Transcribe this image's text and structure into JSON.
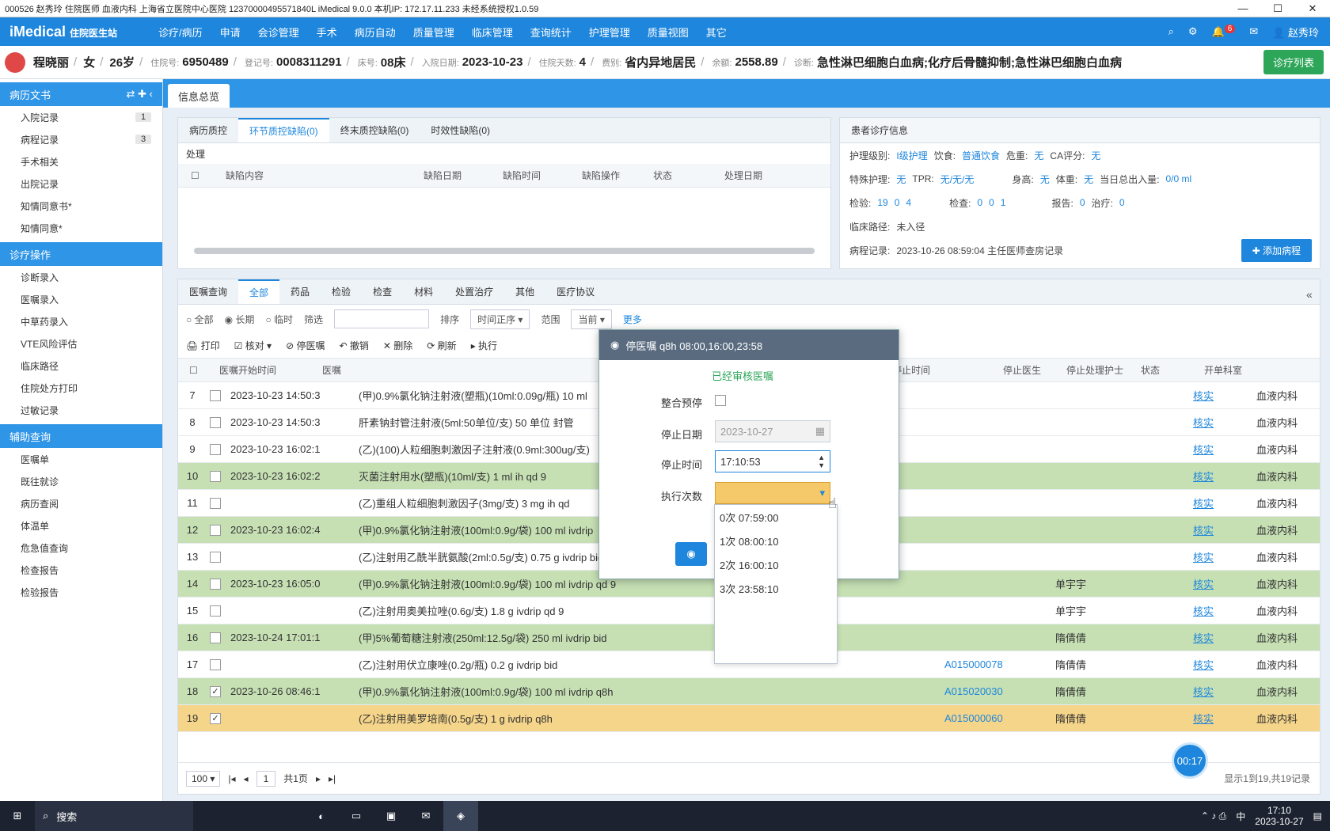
{
  "window": {
    "title": "000526 赵秀玲 住院医师 血液内科 上海省立医院中心医院 12370000495571840L iMedical 9.0.0 本机IP: 172.17.11.233 未经系统授权1.0.59"
  },
  "nav": {
    "logo": "iMedical",
    "sub": "住院医生站",
    "menu": [
      "诊疗/病历",
      "申请",
      "会诊管理",
      "手术",
      "病历自动",
      "质量管理",
      "临床管理",
      "查询统计",
      "护理管理",
      "质量视图",
      "其它"
    ],
    "user": "赵秀玲",
    "badge": "6"
  },
  "patient": {
    "name": "程晓丽",
    "sex": "女",
    "age": "26岁",
    "reg_label": "住院号:",
    "reg_no": "6950489",
    "card_label": "登记号:",
    "card_no": "0008311291",
    "bed_label": "床号:",
    "bed": "08床",
    "admit_label": "入院日期:",
    "admit_date": "2023-10-23",
    "days_label": "住院天数:",
    "days": "4",
    "type_label": "费别:",
    "type": "省内异地居民",
    "fee_label": "余额:",
    "fee": "2558.89",
    "diag_label": "诊断:",
    "diagnosis": "急性淋巴细胞白血病;化疗后骨髓抑制;急性淋巴细胞白血病",
    "btn": "诊疗列表"
  },
  "sidebar": {
    "sec1": "病历文书",
    "items1": [
      {
        "label": "入院记录",
        "count": "1"
      },
      {
        "label": "病程记录",
        "count": "3"
      },
      {
        "label": "手术相关",
        "count": ""
      },
      {
        "label": "出院记录",
        "count": ""
      },
      {
        "label": "知情同意书*",
        "count": ""
      },
      {
        "label": "知情同意*",
        "count": ""
      }
    ],
    "sec2": "诊疗操作",
    "items2": [
      "诊断录入",
      "医嘱录入",
      "中草药录入",
      "VTE风险评估",
      "临床路径",
      "住院处方打印",
      "过敏记录"
    ],
    "sec3": "辅助查询",
    "items3": [
      "医嘱单",
      "既往就诊",
      "病历查阅",
      "体温单",
      "危急值查询",
      "检查报告",
      "检验报告"
    ]
  },
  "tab": {
    "label": "信息总览"
  },
  "top_panel": {
    "tabs": [
      "病历质控",
      "环节质控缺陷(0)",
      "终末质控缺陷(0)",
      "时效性缺陷(0)"
    ],
    "section": "处理",
    "cols": [
      "缺陷内容",
      "缺陷日期",
      "缺陷时间",
      "缺陷操作",
      "状态",
      "处理日期"
    ]
  },
  "info_panel": {
    "title": "患者诊疗信息",
    "r1": [
      "护理级别:",
      "I级护理",
      "饮食:",
      "普通饮食",
      "危重:",
      "无",
      "CA评分:",
      "无"
    ],
    "r2": [
      "特殊护理:",
      "无",
      "TPR:",
      "无/无/无",
      "身高:",
      "无",
      "体重:",
      "无",
      "当日总出入量:",
      "0/0 ml"
    ],
    "r3": [
      "检验:",
      "19",
      "0",
      "4",
      "检查:",
      "0",
      "0",
      "1",
      "报告:",
      "0",
      "治疗:",
      "0"
    ],
    "r4": [
      "临床路径:",
      "未入径"
    ],
    "r5": [
      "病程记录:",
      "2023-10-26 08:59:04 主任医师查房记录"
    ],
    "btn": "添加病程"
  },
  "orders": {
    "tabs": [
      "医嘱查询",
      "全部",
      "药品",
      "检验",
      "检查",
      "材料",
      "处置治疗",
      "其他",
      "医疗协议"
    ],
    "filters": [
      "全部",
      "长期",
      "临时",
      "筛选",
      "排序",
      "时间正序",
      "范围",
      "当前",
      "更多"
    ],
    "toolbar": [
      "打印",
      "核对",
      "停医嘱",
      "撤销",
      "删除",
      "刷新",
      "执行"
    ],
    "cols": [
      "医嘱开始时间",
      "医嘱",
      "停止时间",
      "停止医生",
      "停止处理护士",
      "状态",
      "开单科室"
    ],
    "rows": [
      {
        "n": "7",
        "chk": "",
        "t": "2023-10-23 14:50:3",
        "o": "(甲)0.9%氯化钠注射液(塑瓶)(10ml:0.09g/瓶) 10 ml",
        "c": "",
        "d": "",
        "s": "核实",
        "dept": "血液内科",
        "cls": "white"
      },
      {
        "n": "8",
        "chk": "",
        "t": "2023-10-23 14:50:3",
        "o": "肝素钠封管注射液(5ml:50单位/支) 50 单位 封管",
        "c": "",
        "d": "",
        "s": "核实",
        "dept": "血液内科",
        "cls": "white"
      },
      {
        "n": "9",
        "chk": "",
        "t": "2023-10-23 16:02:1",
        "o": "(乙)(100)人粒细胞刺激因子注射液(0.9ml:300ug/支)",
        "c": "",
        "d": "",
        "s": "核实",
        "dept": "血液内科",
        "cls": "white"
      },
      {
        "n": "10",
        "chk": "",
        "t": "2023-10-23 16:02:2",
        "o": "灭菌注射用水(塑瓶)(10ml/支) 1 ml ih qd 9",
        "c": "",
        "d": "",
        "s": "核实",
        "dept": "血液内科",
        "cls": "green"
      },
      {
        "n": "11",
        "chk": "",
        "t": "",
        "o": "(乙)重组人粒细胞刺激因子(3mg/支) 3 mg ih qd",
        "c": "",
        "d": "",
        "s": "核实",
        "dept": "血液内科",
        "cls": "white"
      },
      {
        "n": "12",
        "chk": "",
        "t": "2023-10-23 16:02:4",
        "o": "(甲)0.9%氯化钠注射液(100ml:0.9g/袋) 100 ml ivdrip",
        "c": "",
        "d": "",
        "s": "核实",
        "dept": "血液内科",
        "cls": "green"
      },
      {
        "n": "13",
        "chk": "",
        "t": "",
        "o": "(乙)注射用乙酰半胱氨酸(2ml:0.5g/支) 0.75 g ivdrip bid",
        "c": "",
        "d": "",
        "s": "核实",
        "dept": "血液内科",
        "cls": "white"
      },
      {
        "n": "14",
        "chk": "",
        "t": "2023-10-23 16:05:0",
        "o": "(甲)0.9%氯化钠注射液(100ml:0.9g/袋) 100 ml ivdrip qd 9",
        "c": "",
        "d": "单宇宇",
        "s": "核实",
        "dept": "血液内科",
        "cls": "green"
      },
      {
        "n": "15",
        "chk": "",
        "t": "",
        "o": "(乙)注射用奥美拉唑(0.6g/支) 1.8 g ivdrip qd 9",
        "c": "",
        "d": "单宇宇",
        "s": "核实",
        "dept": "血液内科",
        "cls": "white"
      },
      {
        "n": "16",
        "chk": "",
        "t": "2023-10-24 17:01:1",
        "o": "(甲)5%葡萄糖注射液(250ml:12.5g/袋) 250 ml ivdrip bid",
        "c": "",
        "d": "隋倩倩",
        "s": "核实",
        "dept": "血液内科",
        "cls": "green"
      },
      {
        "n": "17",
        "chk": "",
        "t": "",
        "o": "(乙)注射用伏立康唑(0.2g/瓶) 0.2 g ivdrip bid",
        "c": "A015000078",
        "d": "隋倩倩",
        "s": "核实",
        "dept": "血液内科",
        "cls": "white"
      },
      {
        "n": "18",
        "chk": "✓",
        "t": "2023-10-26 08:46:1",
        "o": "(甲)0.9%氯化钠注射液(100ml:0.9g/袋) 100 ml ivdrip q8h",
        "c": "A015020030",
        "d": "隋倩倩",
        "s": "核实",
        "dept": "血液内科",
        "cls": "green"
      },
      {
        "n": "19",
        "chk": "✓",
        "t": "",
        "o": "(乙)注射用美罗培南(0.5g/支) 1 g ivdrip q8h",
        "c": "A015000060",
        "d": "隋倩倩",
        "s": "核实",
        "dept": "血液内科",
        "cls": "orange"
      }
    ],
    "pager": {
      "size": "100",
      "page": "1",
      "total": "共1页",
      "summary": "显示1到19,共19记录"
    }
  },
  "modal": {
    "title": "停医嘱 q8h 08:00,16:00,23:58",
    "hint": "已经审核医嘱",
    "f1": "整合预停",
    "f2": "停止日期",
    "f2v": "2023-10-27",
    "f3": "停止时间",
    "f3v": "17:10:53",
    "f4": "执行次数",
    "opts": [
      "0次 07:59:00",
      "1次 08:00:10",
      "2次 16:00:10",
      "3次 23:58:10"
    ]
  },
  "timer": "00:17",
  "taskbar": {
    "search": "搜索",
    "time": "17:10",
    "date": "2023-10-27",
    "ime": "中"
  }
}
